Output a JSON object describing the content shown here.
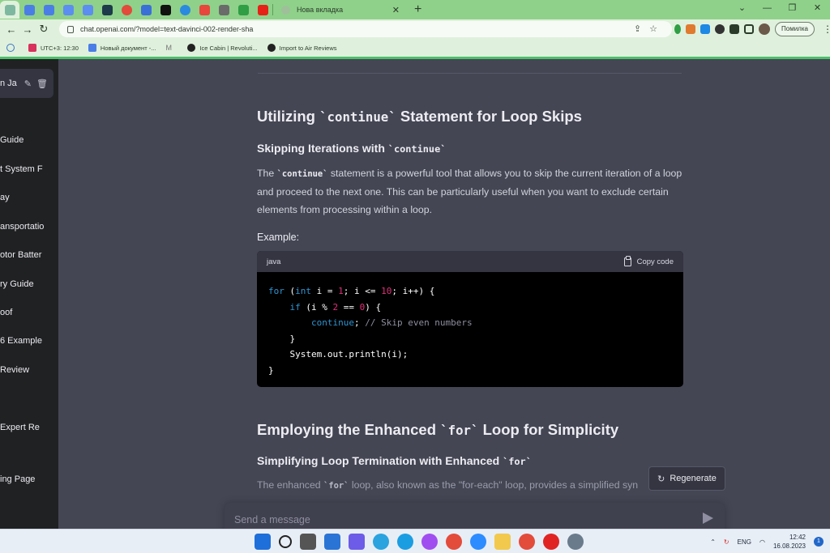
{
  "browser": {
    "new_tab_title": "Нова вкладка",
    "url": "chat.openai.com/?model=text-davinci-002-render-sha",
    "error_pill": "Помилка",
    "bookmarks": [
      "UTC+3: 12:30",
      "Новый документ -...",
      "Ice Cabin | Revoluti...",
      "Import to Air Reviews"
    ]
  },
  "sidebar": {
    "active_label": "n Ja",
    "items": [
      "Guide",
      "t System F",
      "ay",
      "ansportatio",
      "otor Batter",
      "ry Guide",
      "oof",
      "6 Example",
      "Review",
      "Expert Re",
      "ing Page"
    ]
  },
  "article": {
    "section1_title_pre": "Utilizing ",
    "section1_title_code": "`continue`",
    "section1_title_post": " Statement for Loop Skips",
    "section1_sub_pre": "Skipping Iterations with ",
    "section1_sub_code": "`continue`",
    "para_code": "`continue`",
    "para_pre": "The ",
    "para_post": " statement is a powerful tool that allows you to skip the current iteration of a loop and proceed to the next one. This can be particularly useful when you want to exclude certain elements from processing within a loop.",
    "example_label": "Example:",
    "code_lang": "java",
    "copy_label": "Copy code",
    "section2_title_pre": "Employing the Enhanced ",
    "section2_title_code": "`for`",
    "section2_title_post": " Loop for Simplicity",
    "section2_sub_pre": "Simplifying Loop Termination with Enhanced ",
    "section2_sub_code": "`for`",
    "faded_pre": "The enhanced ",
    "faded_code": "`for`",
    "faded_post": " loop, also known as the \"for-each\" loop, provides a simplified syn"
  },
  "regenerate_label": "Regenerate",
  "composer_placeholder": "Send a message",
  "taskbar": {
    "lang": "ENG",
    "time": "12:42",
    "date": "16.08.2023",
    "notifications": "1"
  }
}
